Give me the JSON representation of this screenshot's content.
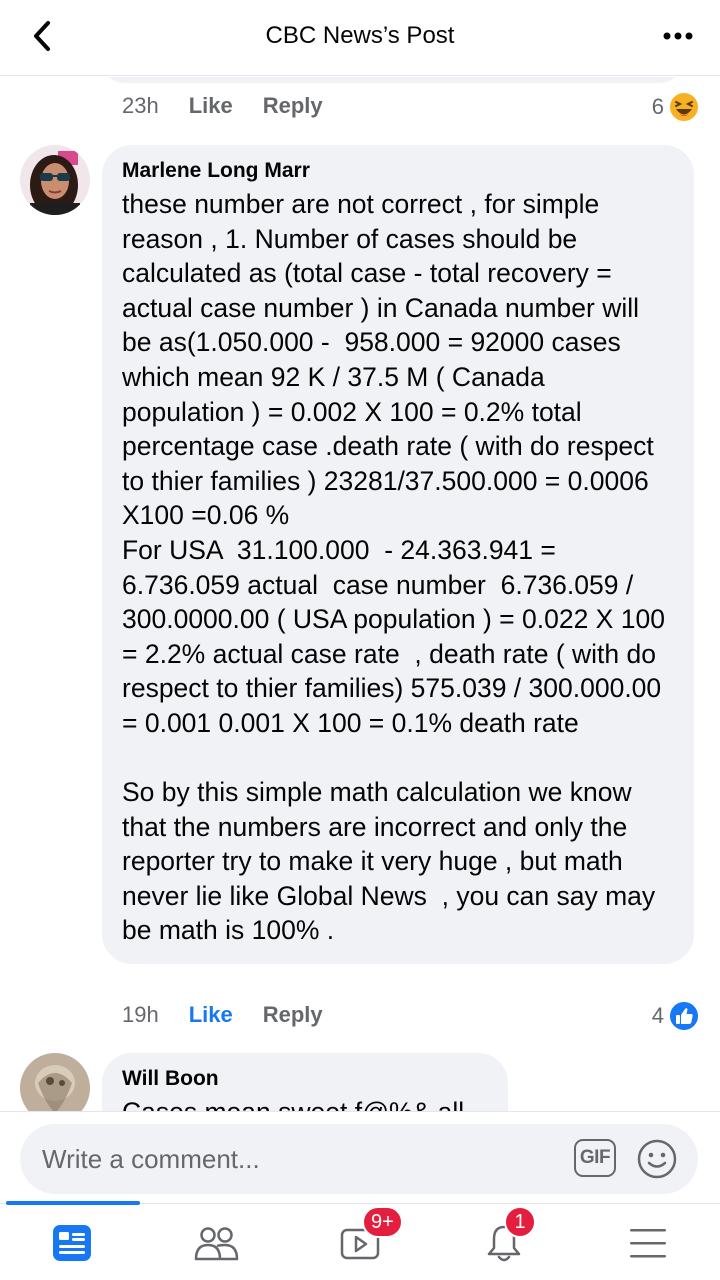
{
  "header": {
    "title": "CBC News’s Post"
  },
  "previous_comment": {
    "time": "23h",
    "like_label": "Like",
    "reply_label": "Reply",
    "reaction_count": "6",
    "reaction_icon": "haha-emoji-icon"
  },
  "comments": [
    {
      "author": "Marlene Long Marr",
      "text": "these number are not correct , for simple reason , 1. Number of cases should be calculated as (total case - total recovery = actual case number ) in Canada number will be as(1.050.000 -  958.000 = 92000 cases which mean 92 K / 37.5 M ( Canada population ) = 0.002 X 100 = 0.2% total percentage case .death rate ( with do respect to thier families ) 23281/37.500.000 = 0.0006 X100 =0.06 %\nFor USA  31.100.000  - 24.363.941 = 6.736.059 actual  case number  6.736.059 / 300.0000.00 ( USA population ) = 0.022 X 100 = 2.2% actual case rate  , death rate ( with do respect to thier families) 575.039 / 300.000.00 = 0.001 0.001 X 100 = 0.1% death rate\n\nSo by this simple math calculation we know that the numbers are incorrect and only the reporter try to make it very huge , but math never lie like Global News  , you can say may be math is 100% .",
      "time": "19h",
      "like_label": "Like",
      "reply_label": "Reply",
      "reaction_count": "4",
      "reaction_icon": "like-thumb-icon"
    },
    {
      "author": "Will Boon",
      "text": "Cases mean sweet f@%& all"
    }
  ],
  "composer": {
    "placeholder": "Write a comment...",
    "gif_label": "GIF"
  },
  "bottom_nav": {
    "items": [
      {
        "name": "news-feed",
        "icon": "news-feed-icon",
        "active": true
      },
      {
        "name": "friends",
        "icon": "friends-icon"
      },
      {
        "name": "watch",
        "icon": "watch-icon",
        "badge": "9+"
      },
      {
        "name": "notifications",
        "icon": "bell-icon",
        "badge": "1"
      },
      {
        "name": "menu",
        "icon": "hamburger-menu-icon"
      }
    ]
  },
  "colors": {
    "accent": "#1877f2",
    "bubble": "#f0f2f5",
    "secondary_text": "#65676b",
    "badge": "#e41e3f"
  }
}
